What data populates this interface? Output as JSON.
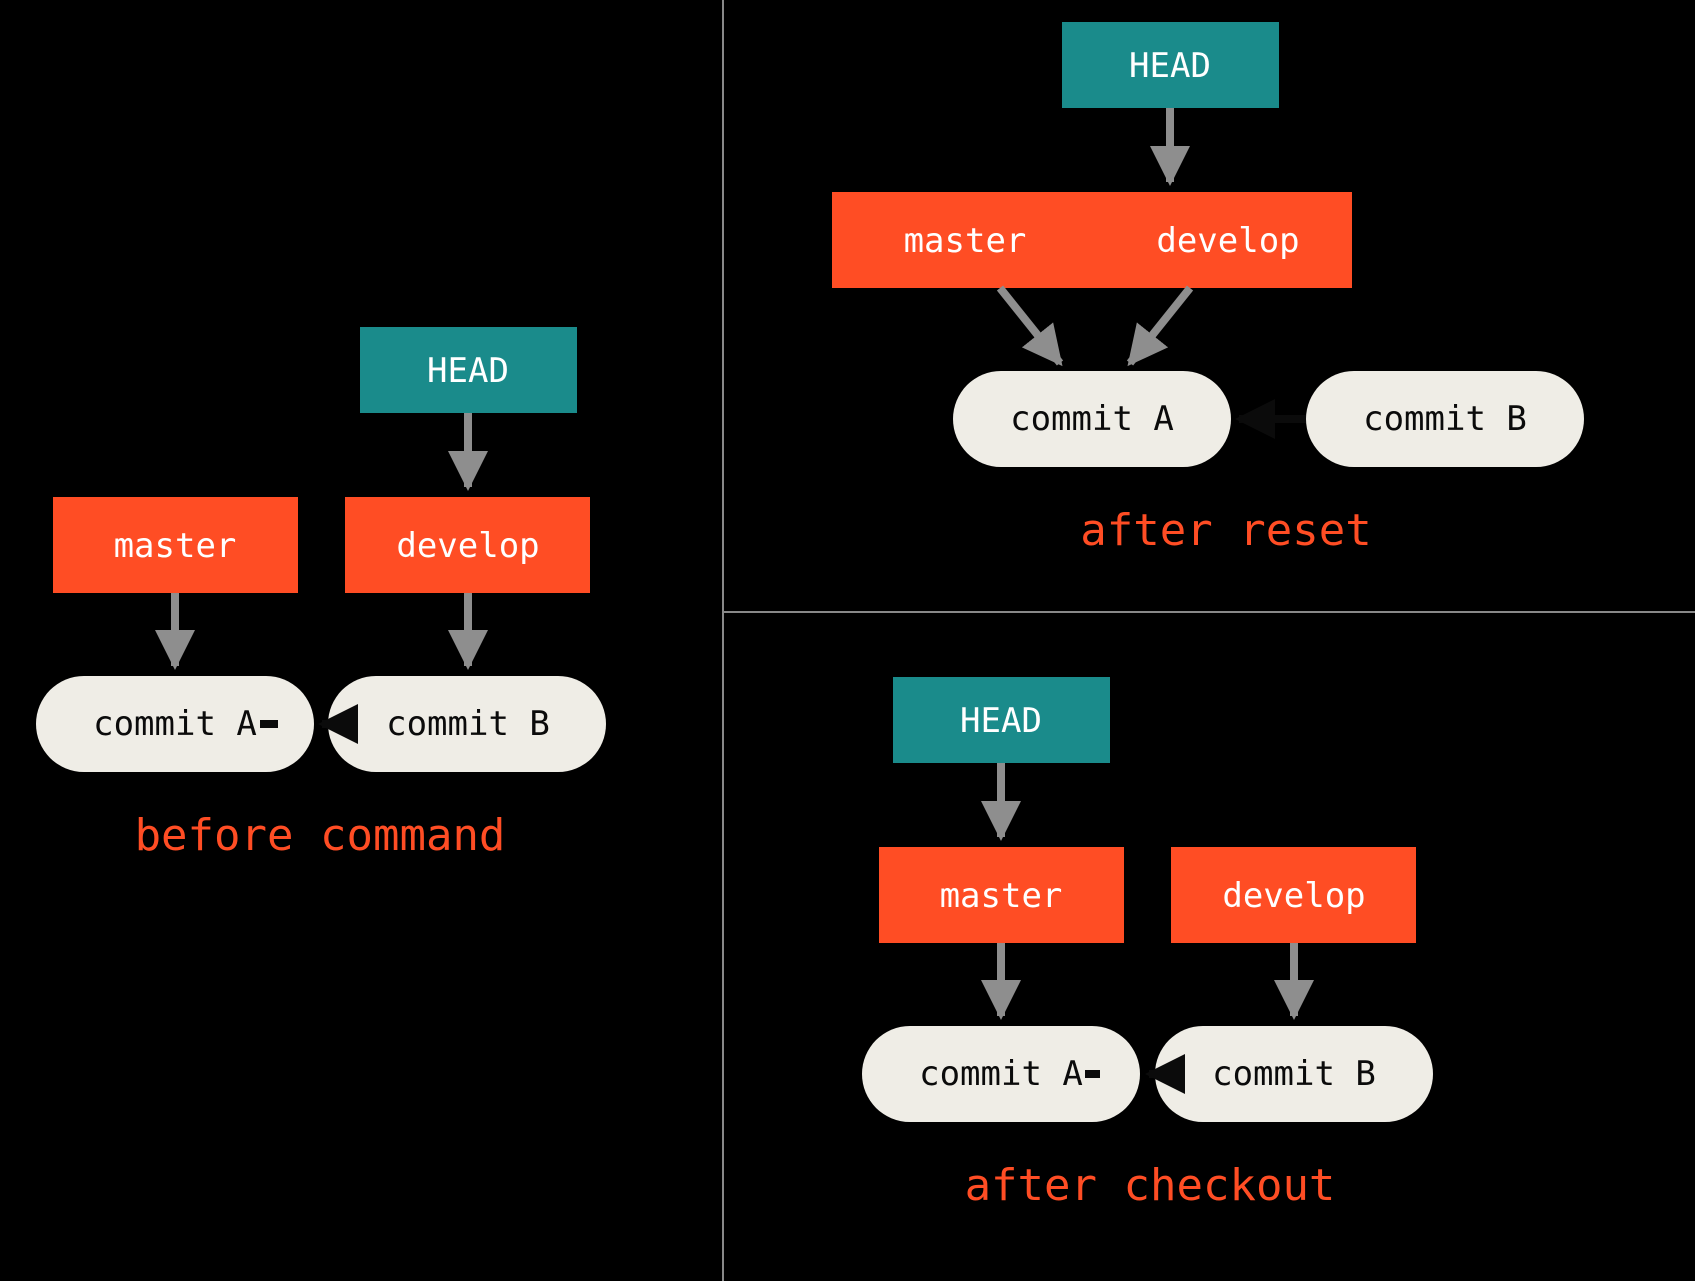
{
  "labels": {
    "head": "HEAD",
    "master": "master",
    "develop": "develop",
    "commitA": "commit A",
    "commitB": "commit B"
  },
  "captions": {
    "before": "before command",
    "reset": "after reset",
    "checkout": "after checkout"
  }
}
